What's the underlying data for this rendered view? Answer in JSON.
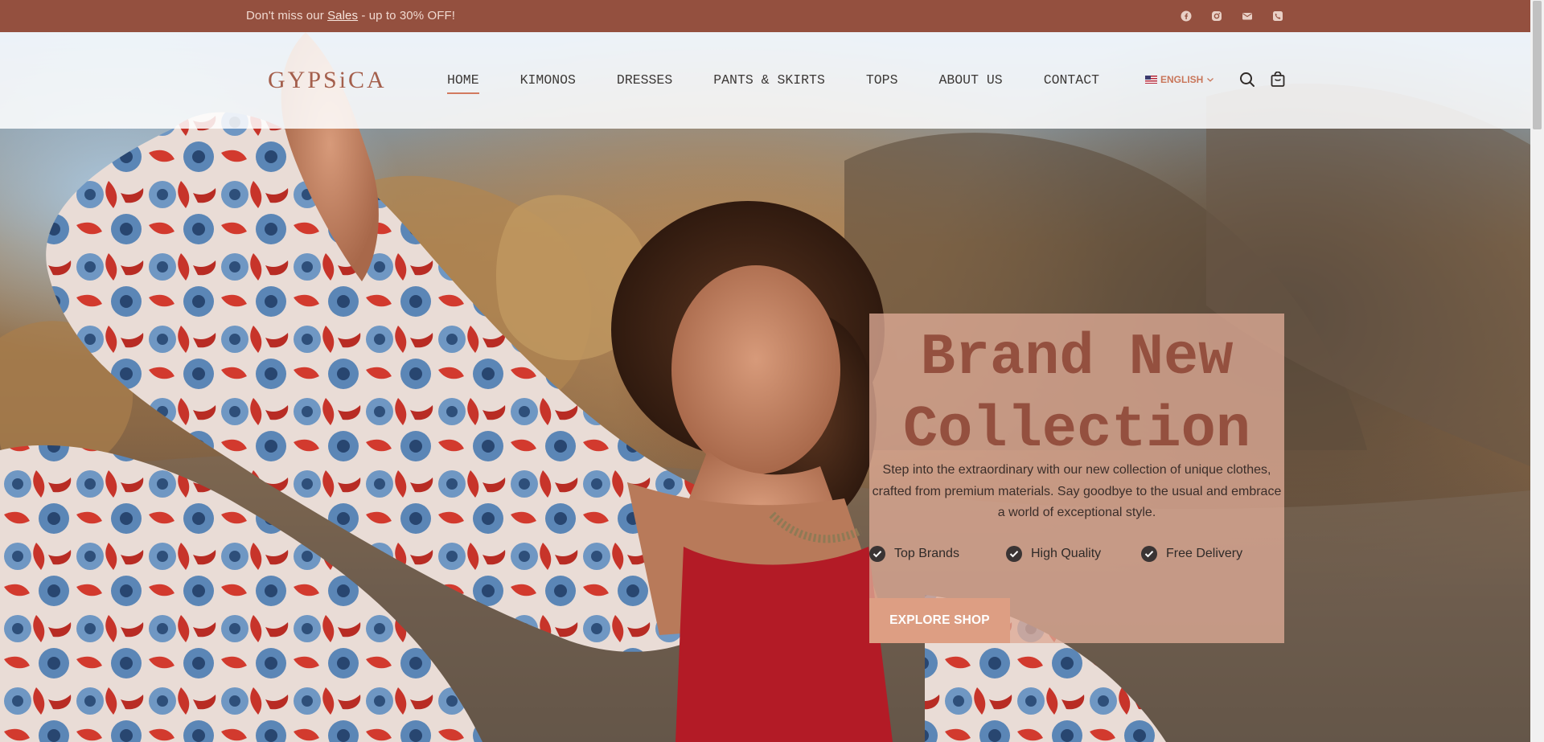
{
  "topbar": {
    "promo_prefix": "Don't miss our ",
    "promo_link": "Sales",
    "promo_suffix": " - up to 30% OFF!",
    "social_icons": [
      "facebook-icon",
      "instagram-icon",
      "email-icon",
      "phone-icon"
    ]
  },
  "header": {
    "logo": "GYPSiCA",
    "nav": [
      {
        "label": "HOME",
        "active": true
      },
      {
        "label": "KIMONOS"
      },
      {
        "label": "DRESSES"
      },
      {
        "label": "PANTS & SKIRTS"
      },
      {
        "label": "TOPS"
      },
      {
        "label": "ABOUT US"
      },
      {
        "label": "CONTACT"
      }
    ],
    "language": "ENGLISH",
    "icons": [
      "search-icon",
      "cart-icon"
    ]
  },
  "hero": {
    "title": "Brand New Collection",
    "description": "Step into the extraordinary with our new collection of unique clothes, crafted from premium materials. Say goodbye to the usual and embrace a world of exceptional style.",
    "features": [
      "Top Brands",
      "High Quality",
      "Free Delivery"
    ],
    "cta": "EXPLORE SHOP"
  },
  "colors": {
    "brand": "#94503f",
    "accent": "#d27a5f",
    "button": "#dd9e83",
    "card": "#deaa96"
  }
}
